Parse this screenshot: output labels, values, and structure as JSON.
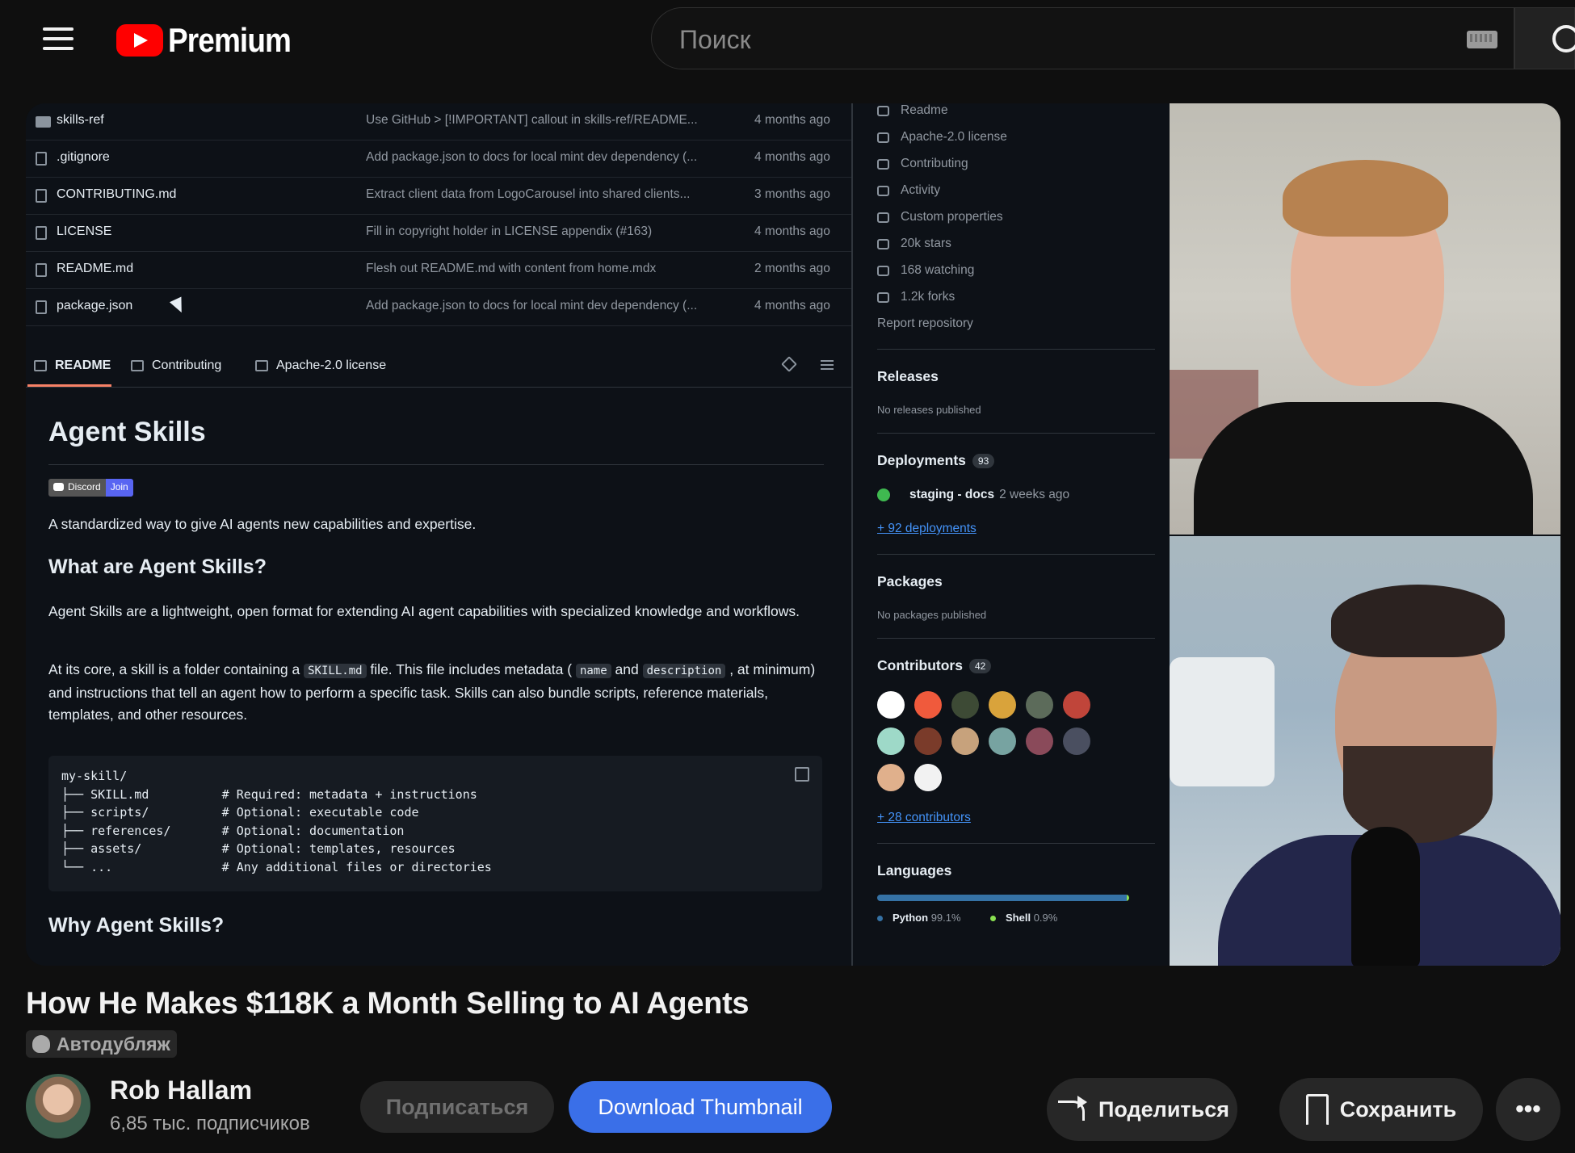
{
  "header": {
    "logo_text": "Premium",
    "search_placeholder": "Поиск"
  },
  "video_content": {
    "files": [
      {
        "name": "skills-ref",
        "type": "folder",
        "message": "Use GitHub > [!IMPORTANT] callout in skills-ref/README...",
        "time": "4 months ago"
      },
      {
        "name": ".gitignore",
        "type": "file",
        "message": "Add package.json to docs for local mint dev dependency (...",
        "time": "4 months ago"
      },
      {
        "name": "CONTRIBUTING.md",
        "type": "file",
        "message": "Extract client data from LogoCarousel into shared clients...",
        "time": "3 months ago"
      },
      {
        "name": "LICENSE",
        "type": "file",
        "message": "Fill in copyright holder in LICENSE appendix (#163)",
        "time": "4 months ago"
      },
      {
        "name": "README.md",
        "type": "file",
        "message": "Flesh out README.md with content from home.mdx",
        "time": "2 months ago"
      },
      {
        "name": "package.json",
        "type": "file",
        "message": "Add package.json to docs for local mint dev dependency (...",
        "time": "4 months ago"
      }
    ],
    "readme_tabs": [
      "README",
      "Contributing",
      "Apache-2.0 license"
    ],
    "readme": {
      "h1": "Agent Skills",
      "badge_left": "Discord",
      "badge_right": "Join",
      "intro": "A standardized way to give AI agents new capabilities and expertise.",
      "h2_what": "What are Agent Skills?",
      "p1": "Agent Skills are a lightweight, open format for extending AI agent capabilities with specialized knowledge and workflows.",
      "p2_a": "At its core, a skill is a folder containing a ",
      "p2_code1": "SKILL.md",
      "p2_b": " file. This file includes metadata ( ",
      "p2_code2": "name",
      "p2_c": " and ",
      "p2_code3": "description",
      "p2_d": " , at minimum) and instructions that tell an agent how to perform a specific task. Skills can also bundle scripts, reference materials, templates, and other resources.",
      "code_block": "my-skill/\n├── SKILL.md          # Required: metadata + instructions\n├── scripts/          # Optional: executable code\n├── references/       # Optional: documentation\n├── assets/           # Optional: templates, resources\n└── ...               # Any additional files or directories",
      "h2_why": "Why Agent Skills?"
    },
    "sidebar": {
      "links": [
        "Readme",
        "Apache-2.0 license",
        "Contributing",
        "Activity",
        "Custom properties",
        "20k stars",
        "168 watching",
        "1.2k forks",
        "Report repository"
      ],
      "releases_title": "Releases",
      "releases_text": "No releases published",
      "deployments_title": "Deployments",
      "deployments_count": "93",
      "deployment_name": "staging - docs",
      "deployment_time": "2 weeks ago",
      "more_deployments": "+ 92 deployments",
      "packages_title": "Packages",
      "packages_text": "No packages published",
      "contributors_title": "Contributors",
      "contributors_count": "42",
      "more_contributors": "+ 28 contributors",
      "languages_title": "Languages",
      "lang1_name": "Python",
      "lang1_pct": "99.1%",
      "lang2_name": "Shell",
      "lang2_pct": "0.9%",
      "avatar_colors": [
        "#ffffff",
        "#f05a3c",
        "#3d4a35",
        "#d9a33b",
        "#5c6b5a",
        "#c0453a",
        "#9ed9c8",
        "#7a3b2a",
        "#c7a27c",
        "#77a3a1",
        "#8a4a5a",
        "#4a4f60",
        "#e0b08c",
        "#f2f2f2"
      ]
    }
  },
  "video": {
    "title": "How He Makes $118K a Month Selling to AI Agents",
    "dub_label": "Автодубляж"
  },
  "channel": {
    "name": "Rob Hallam",
    "subscribers": "6,85 тыс. подписчиков"
  },
  "actions": {
    "subscribe": "Подписаться",
    "download": "Download Thumbnail",
    "share": "Поделиться",
    "save": "Сохранить",
    "more": "•••"
  },
  "colors": {
    "accent_blue": "#3a6fe8",
    "youtube_red": "#ff0000",
    "background": "#0f0f0f"
  }
}
